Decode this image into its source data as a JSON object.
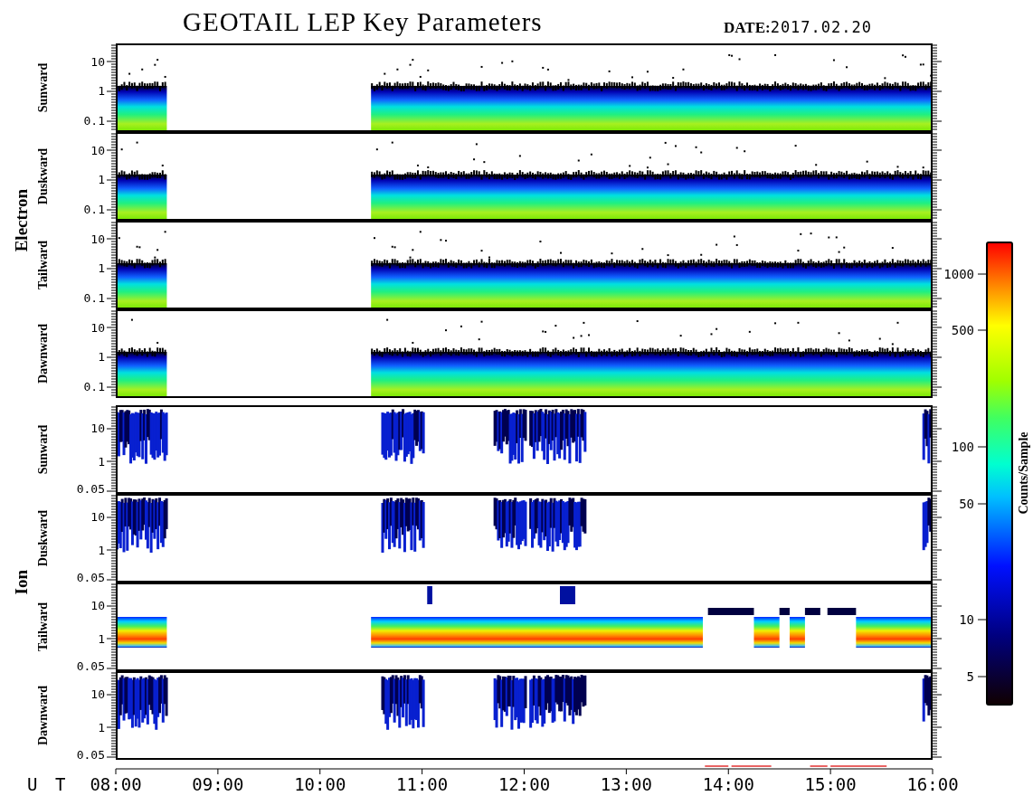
{
  "title": "GEOTAIL LEP Key Parameters",
  "date": {
    "label": "DATE:",
    "value": "2017.02.20"
  },
  "groups": [
    {
      "name": "Electron",
      "panels": [
        {
          "label": "Sunward",
          "kind": "electron",
          "yticks": [
            "10",
            "1",
            "0.1"
          ]
        },
        {
          "label": "Duskward",
          "kind": "electron",
          "yticks": [
            "10",
            "1",
            "0.1"
          ]
        },
        {
          "label": "Tailward",
          "kind": "electron",
          "yticks": [
            "10",
            "1",
            "0.1"
          ]
        },
        {
          "label": "Dawnward",
          "kind": "electron",
          "yticks": [
            "10",
            "1",
            "0.1"
          ]
        }
      ]
    },
    {
      "name": "Ion",
      "panels": [
        {
          "label": "Sunward",
          "kind": "ion_sparse",
          "yticks": [
            "10",
            "1",
            "0.05"
          ]
        },
        {
          "label": "Duskward",
          "kind": "ion_sparse",
          "yticks": [
            "10",
            "1",
            "0.05"
          ]
        },
        {
          "label": "Tailward",
          "kind": "ion_band",
          "yticks": [
            "10",
            "1",
            "0.05"
          ]
        },
        {
          "label": "Dawnward",
          "kind": "ion_sparse",
          "yticks": [
            "10",
            "1",
            "0.05"
          ]
        }
      ]
    }
  ],
  "x_axis": {
    "label": "U T",
    "ticks": [
      "08:00",
      "09:00",
      "10:00",
      "11:00",
      "12:00",
      "13:00",
      "14:00",
      "15:00",
      "16:00"
    ]
  },
  "colorbar": {
    "label": "Counts/Sample",
    "ticks": [
      "1000",
      "500",
      "100",
      "50",
      "10",
      "5"
    ]
  }
}
